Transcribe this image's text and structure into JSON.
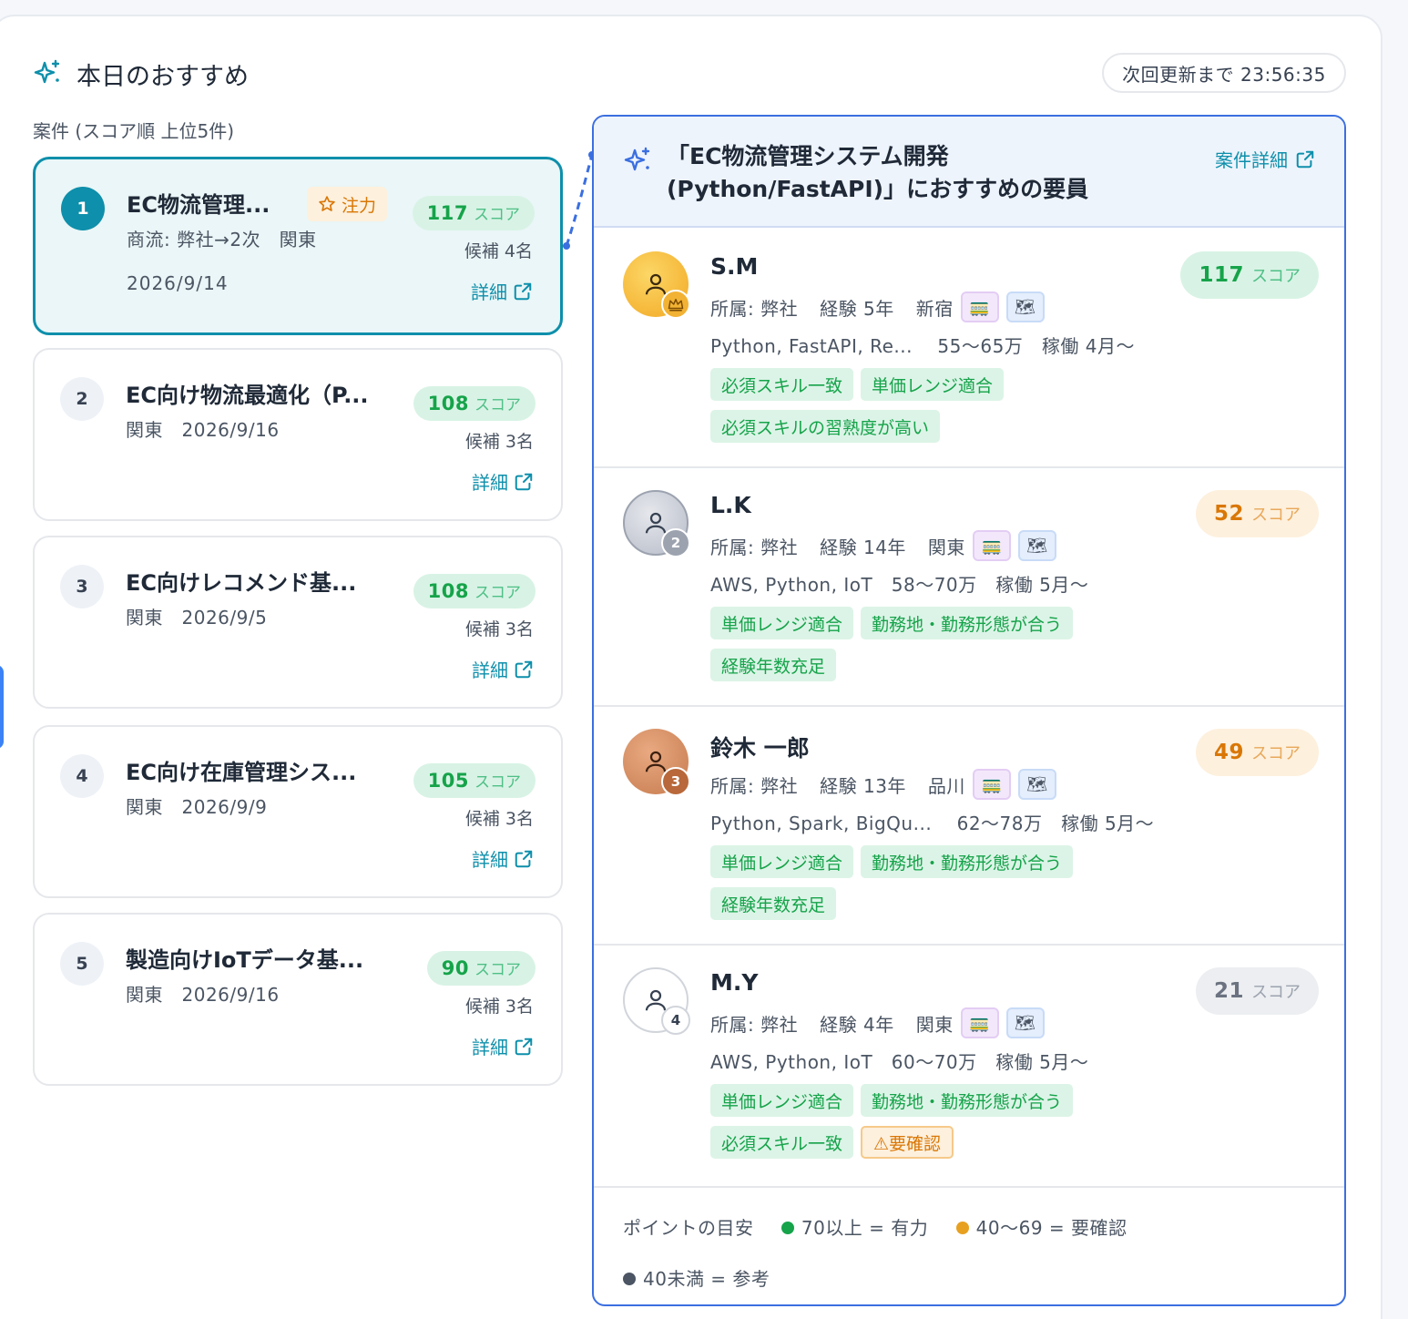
{
  "header": {
    "title": "本日のおすすめ",
    "countdown": "次回更新まで 23:56:35"
  },
  "list": {
    "caption": "案件 (スコア順 上位5件)",
    "projects": [
      {
        "rank": "1",
        "title": "EC物流管理...",
        "badge": "注力",
        "sub": "商流: 弊社→2次　関東",
        "date": "2026/9/14",
        "score": "117",
        "score_unit": "スコア",
        "candidates": "候補 4名",
        "detail": "詳細"
      },
      {
        "rank": "2",
        "title": "EC向け物流最適化（P...",
        "sub": "関東　2026/9/16",
        "score": "108",
        "score_unit": "スコア",
        "candidates": "候補 3名",
        "detail": "詳細"
      },
      {
        "rank": "3",
        "title": "EC向けレコメンド基...",
        "sub": "関東　2026/9/5",
        "score": "108",
        "score_unit": "スコア",
        "candidates": "候補 3名",
        "detail": "詳細"
      },
      {
        "rank": "4",
        "title": "EC向け在庫管理シス...",
        "sub": "関東　2026/9/9",
        "score": "105",
        "score_unit": "スコア",
        "candidates": "候補 3名",
        "detail": "詳細"
      },
      {
        "rank": "5",
        "title": "製造向けIoTデータ基...",
        "sub": "関東　2026/9/16",
        "score": "90",
        "score_unit": "スコア",
        "candidates": "候補 3名",
        "detail": "詳細"
      }
    ]
  },
  "recommend": {
    "title": "「EC物流管理システム開発(Python/FastAPI)」におすすめの要員",
    "detail_link": "案件詳細",
    "candidates": [
      {
        "rank": "",
        "name": "S.M",
        "affiliation": "所属: 弊社",
        "experience": "経験 5年",
        "location": "新宿",
        "skills": "Python, FastAPI, Re...",
        "price": "55〜65万",
        "start": "稼働 4月〜",
        "score": "117",
        "score_unit": "スコア",
        "tags": [
          "必須スキル一致",
          "単価レンジ適合",
          "必須スキルの習熟度が高い"
        ]
      },
      {
        "rank": "2",
        "name": "L.K",
        "affiliation": "所属: 弊社",
        "experience": "経験 14年",
        "location": "関東",
        "skills": "AWS, Python, IoT",
        "price": "58〜70万",
        "start": "稼働 5月〜",
        "score": "52",
        "score_unit": "スコア",
        "tags": [
          "単価レンジ適合",
          "勤務地・勤務形態が合う",
          "経験年数充足"
        ]
      },
      {
        "rank": "3",
        "name": "鈴木 一郎",
        "affiliation": "所属: 弊社",
        "experience": "経験 13年",
        "location": "品川",
        "skills": "Python, Spark, BigQu...",
        "price": "62〜78万",
        "start": "稼働 5月〜",
        "score": "49",
        "score_unit": "スコア",
        "tags": [
          "単価レンジ適合",
          "勤務地・勤務形態が合う",
          "経験年数充足"
        ]
      },
      {
        "rank": "4",
        "name": "M.Y",
        "affiliation": "所属: 弊社",
        "experience": "経験 4年",
        "location": "関東",
        "skills": "AWS, Python, IoT",
        "price": "60〜70万",
        "start": "稼働 5月〜",
        "score": "21",
        "score_unit": "スコア",
        "tags": [
          "単価レンジ適合",
          "勤務地・勤務形態が合う",
          "必須スキル一致"
        ],
        "warn_tag": "⚠要確認"
      }
    ],
    "legend": {
      "label": "ポイントの目安",
      "items": [
        "70以上 = 有力",
        "40〜69 = 要確認",
        "40未満 = 参考"
      ]
    }
  },
  "colors": {
    "accent": "#0e8fab",
    "strong": "#16a34a",
    "check": "#e8a020",
    "reference": "#4b5563",
    "panel_border": "#3b6fe0"
  },
  "icons": {
    "header": "sparkles-icon",
    "focus": "star-icon",
    "link": "external-link-icon",
    "avatar": "user-icon",
    "top_rank": "crown-icon",
    "commute": "train-icon",
    "area": "map-icon"
  }
}
